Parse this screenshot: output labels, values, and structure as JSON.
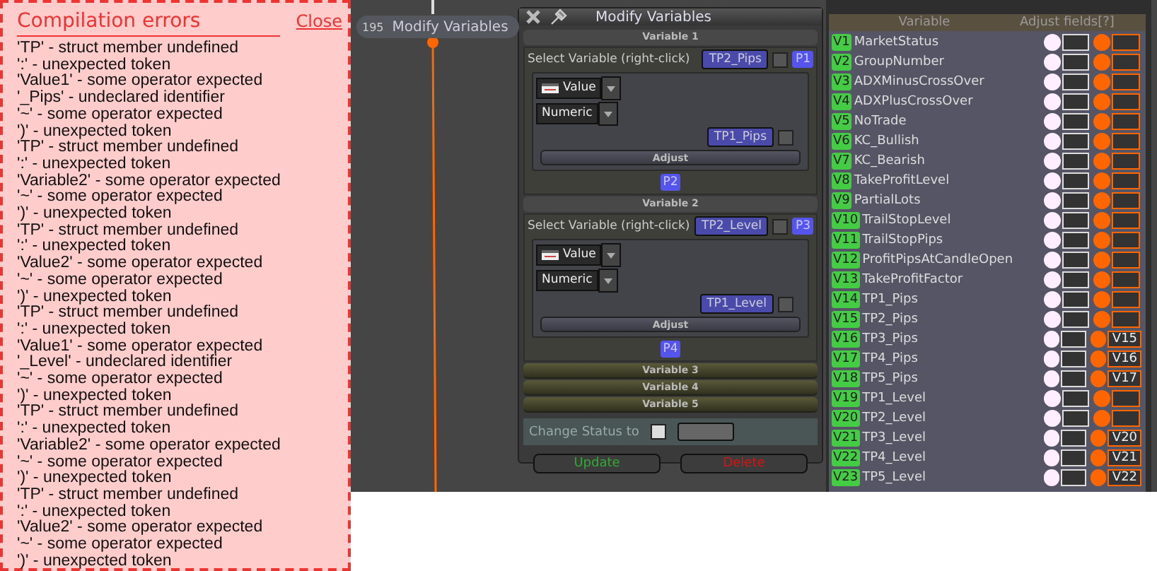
{
  "error_panel": {
    "title": "Compilation errors",
    "close": "Close",
    "lines": [
      "'TP' - struct member undefined",
      "':' - unexpected token",
      "'Value1' - some operator expected",
      "'_Pips' - undeclared identifier",
      "'~' - some operator expected",
      "')' - unexpected token",
      "'TP' - struct member undefined",
      "':' - unexpected token",
      "'Variable2' - some operator expected",
      "'~' - some operator expected",
      "')' - unexpected token",
      "'TP' - struct member undefined",
      "':' - unexpected token",
      "'Value2' - some operator expected",
      "'~' - some operator expected",
      "')' - unexpected token",
      "'TP' - struct member undefined",
      "':' - unexpected token",
      "'Value1' - some operator expected",
      "'_Level' - undeclared identifier",
      "'~' - some operator expected",
      "')' - unexpected token",
      "'TP' - struct member undefined",
      "':' - unexpected token",
      "'Variable2' - some operator expected",
      "'~' - some operator expected",
      "')' - unexpected token",
      "'TP' - struct member undefined",
      "':' - unexpected token",
      "'Value2' - some operator expected",
      "'~' - some operator expected",
      "')' - unexpected token"
    ]
  },
  "node": {
    "number": "195",
    "label": "Modify Variables"
  },
  "dialog": {
    "title": "Modify Variables",
    "sections": [
      {
        "header": "Variable 1",
        "expanded": true,
        "select_label": "Select Variable (right-click)",
        "variable": "TP2_Pips",
        "variable_checked": false,
        "pin_top": "P1",
        "type": "Value",
        "format": "Numeric",
        "value_var": "TP1_Pips",
        "value_checked": false,
        "adjust": "Adjust",
        "pin_bottom": "P2"
      },
      {
        "header": "Variable 2",
        "expanded": true,
        "select_label": "Select Variable (right-click)",
        "variable": "TP2_Level",
        "variable_checked": false,
        "pin_top": "P3",
        "type": "Value",
        "format": "Numeric",
        "value_var": "TP1_Level",
        "value_checked": false,
        "adjust": "Adjust",
        "pin_bottom": "P4"
      },
      {
        "header": "Variable 3",
        "expanded": false
      },
      {
        "header": "Variable 4",
        "expanded": false
      },
      {
        "header": "Variable 5",
        "expanded": false
      }
    ],
    "change_status": {
      "label": "Change Status to",
      "checked": false
    },
    "buttons": [
      {
        "label": "Update",
        "kind": "update"
      },
      {
        "label": "Delete",
        "kind": "delete"
      }
    ]
  },
  "variables_panel": {
    "columns": [
      "Variable",
      "Adjust fields[?]"
    ],
    "rows": [
      {
        "id": "V1",
        "name": "MarketStatus"
      },
      {
        "id": "V2",
        "name": "GroupNumber"
      },
      {
        "id": "V3",
        "name": "ADXMinusCrossOver"
      },
      {
        "id": "V4",
        "name": "ADXPlusCrossOver"
      },
      {
        "id": "V5",
        "name": "NoTrade"
      },
      {
        "id": "V6",
        "name": "KC_Bullish"
      },
      {
        "id": "V7",
        "name": "KC_Bearish"
      },
      {
        "id": "V8",
        "name": "TakeProfitLevel"
      },
      {
        "id": "V9",
        "name": "PartialLots"
      },
      {
        "id": "V10",
        "name": "TrailStopLevel"
      },
      {
        "id": "V11",
        "name": "TrailStopPips"
      },
      {
        "id": "V12",
        "name": "ProfitPipsAtCandleOpen"
      },
      {
        "id": "V13",
        "name": "TakeProfitFactor"
      },
      {
        "id": "V14",
        "name": "TP1_Pips"
      },
      {
        "id": "V15",
        "name": "TP2_Pips"
      },
      {
        "id": "V16",
        "name": "TP3_Pips",
        "link": "V15"
      },
      {
        "id": "V17",
        "name": "TP4_Pips",
        "link": "V16"
      },
      {
        "id": "V18",
        "name": "TP5_Pips",
        "link": "V17"
      },
      {
        "id": "V19",
        "name": "TP1_Level"
      },
      {
        "id": "V20",
        "name": "TP2_Level"
      },
      {
        "id": "V21",
        "name": "TP3_Level",
        "link": "V20"
      },
      {
        "id": "V22",
        "name": "TP4_Level",
        "link": "V21"
      },
      {
        "id": "V23",
        "name": "TP5_Level",
        "link": "V22"
      }
    ]
  }
}
